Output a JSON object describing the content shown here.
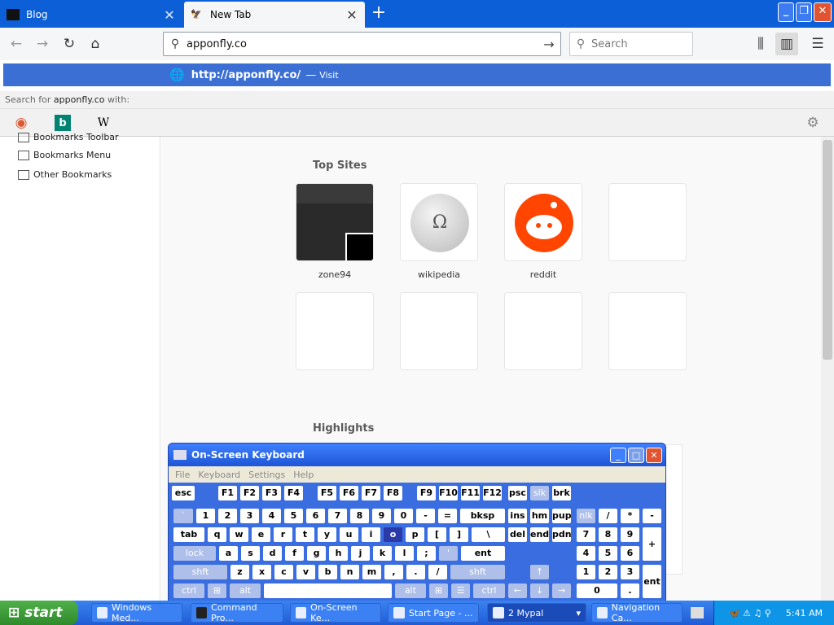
{
  "tabs": [
    {
      "title": "Blog",
      "active": false
    },
    {
      "title": "New Tab",
      "active": true
    }
  ],
  "nav": {
    "url_value": "apponfly.co",
    "search_placeholder": "Search"
  },
  "suggestion": {
    "url": "http://apponfly.co/",
    "separator": "—",
    "action": "Visit"
  },
  "search_for": {
    "prefix": "Search for",
    "query": "apponfly.co",
    "suffix": "with:"
  },
  "engines": [
    {
      "name": "duckduckgo-icon",
      "glyph": "◉",
      "color": "#de5833"
    },
    {
      "name": "bing-icon",
      "glyph": "b",
      "color": "#008373"
    },
    {
      "name": "wikipedia-icon",
      "glyph": "W",
      "color": "#000000"
    }
  ],
  "sidebar": {
    "items": [
      {
        "label": "Bookmarks Toolbar"
      },
      {
        "label": "Bookmarks Menu"
      },
      {
        "label": "Other Bookmarks"
      }
    ]
  },
  "content": {
    "top_sites_title": "Top Sites",
    "highlights_title": "Highlights",
    "sites": [
      {
        "label": "zone94"
      },
      {
        "label": "wikipedia"
      },
      {
        "label": "reddit"
      }
    ]
  },
  "osk": {
    "title": "On-Screen Keyboard",
    "menu": [
      "File",
      "Keyboard",
      "Settings",
      "Help"
    ]
  },
  "taskbar": {
    "start": "start",
    "tasks": [
      {
        "label": "Windows Med..."
      },
      {
        "label": "Command Pro..."
      },
      {
        "label": "On-Screen Ke..."
      },
      {
        "label": "Start Page - ..."
      },
      {
        "label": "2 Mypal"
      },
      {
        "label": "Navigation Ca..."
      }
    ],
    "clock": "5:41 AM"
  },
  "colors": {
    "accent": "#0c5fd6",
    "suggestion_bg": "#3b6fd4",
    "reddit": "#ff4500",
    "taskbar": "#245edb",
    "start": "#3c9a37"
  }
}
